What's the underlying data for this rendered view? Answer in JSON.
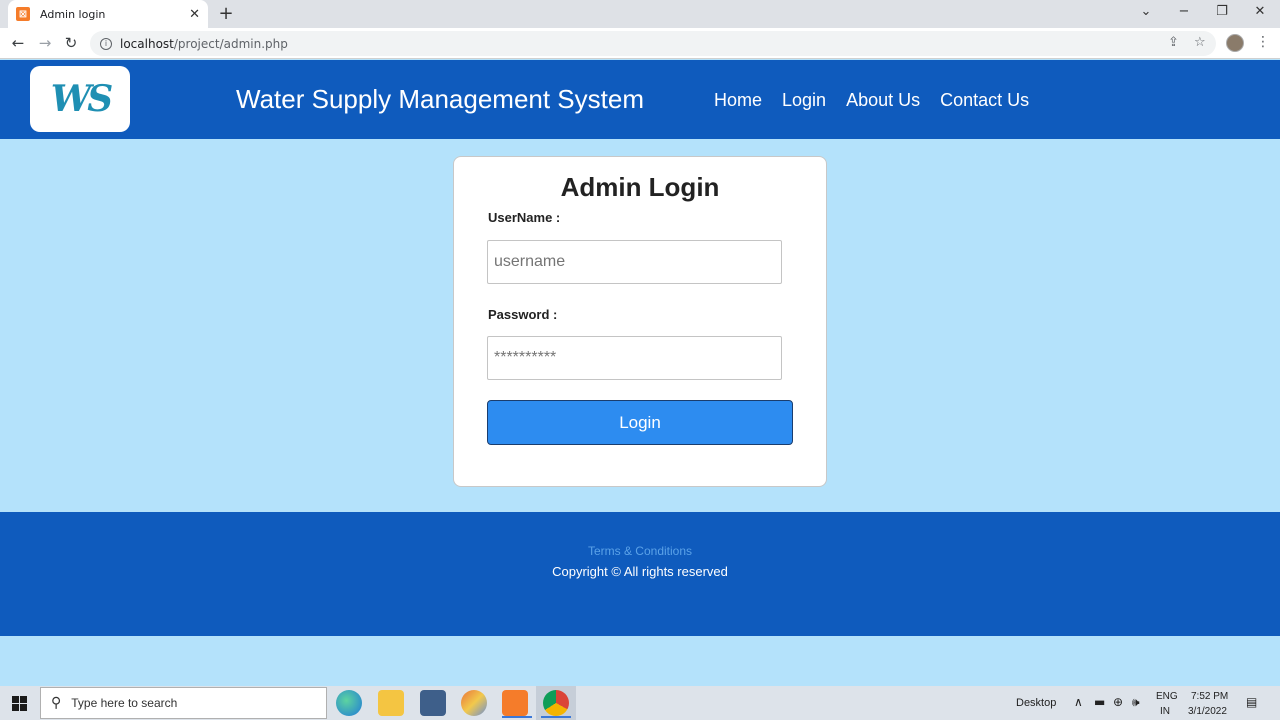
{
  "browser": {
    "tab_title": "Admin login",
    "url_host": "localhost",
    "url_path": "/project/admin.php"
  },
  "site": {
    "logo_text": "WS",
    "title": "Water Supply Management System",
    "nav": [
      "Home",
      "Login",
      "About Us",
      "Contact Us"
    ]
  },
  "login": {
    "title": "Admin Login",
    "username_label": "UserName :",
    "username_placeholder": "username",
    "password_label": "Password :",
    "password_placeholder": "**********",
    "button_label": "Login"
  },
  "footer": {
    "terms": "Terms & Conditions",
    "copyright": "Copyright © All rights reserved"
  },
  "taskbar": {
    "search_placeholder": "Type here to search",
    "desktop_label": "Desktop",
    "lang_line1": "ENG",
    "lang_line2": "IN",
    "time": "7:52 PM",
    "date": "3/1/2022"
  },
  "colors": {
    "header_bg": "#0f5bbd",
    "page_bg": "#b4e2fb",
    "button_bg": "#2d8cf0"
  }
}
